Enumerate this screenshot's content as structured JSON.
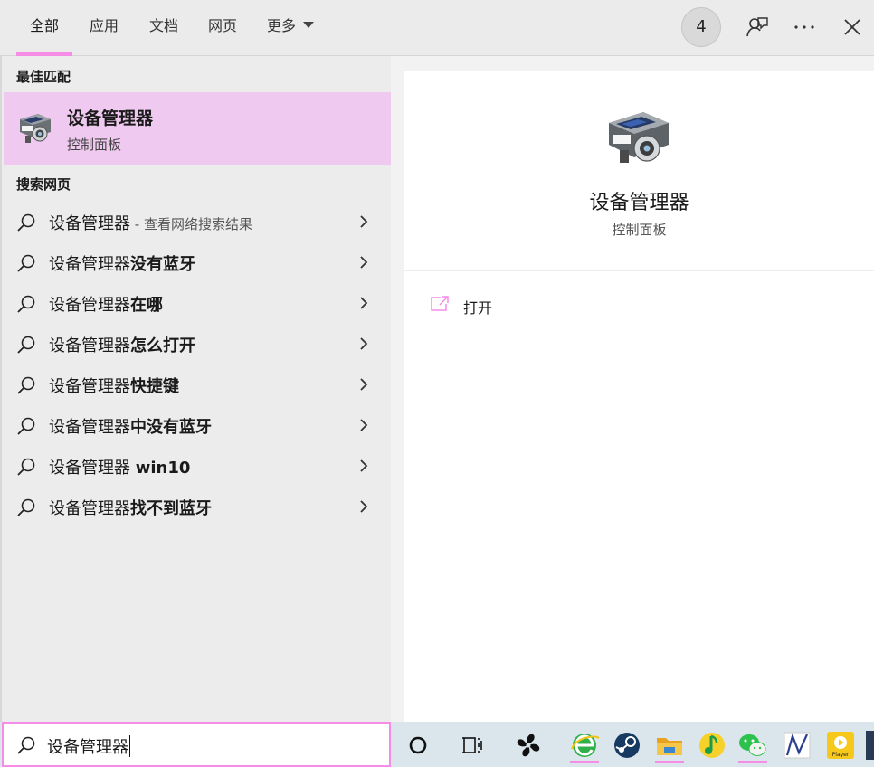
{
  "tabs": [
    {
      "label": "全部",
      "active": true
    },
    {
      "label": "应用",
      "active": false
    },
    {
      "label": "文档",
      "active": false
    },
    {
      "label": "网页",
      "active": false
    },
    {
      "label": "更多",
      "active": false
    }
  ],
  "top_actions": {
    "reward_count": "4",
    "icons": [
      "feedback-icon",
      "more-icon",
      "close-icon"
    ]
  },
  "best_match": {
    "section_title": "最佳匹配",
    "title": "设备管理器",
    "subtitle": "控制面板",
    "icon": "device-manager-icon"
  },
  "web_search": {
    "section_title": "搜索网页",
    "items": [
      {
        "base": "设备管理器",
        "bold": "",
        "hint": " - 查看网络搜索结果"
      },
      {
        "base": "设备管理器",
        "bold": "没有蓝牙",
        "hint": ""
      },
      {
        "base": "设备管理器",
        "bold": "在哪",
        "hint": ""
      },
      {
        "base": "设备管理器",
        "bold": "怎么打开",
        "hint": ""
      },
      {
        "base": "设备管理器",
        "bold": "快捷键",
        "hint": ""
      },
      {
        "base": "设备管理器",
        "bold": "中没有蓝牙",
        "hint": ""
      },
      {
        "base": "设备管理器 ",
        "bold": "win10",
        "hint": ""
      },
      {
        "base": "设备管理器",
        "bold": "找不到蓝牙",
        "hint": ""
      }
    ]
  },
  "detail": {
    "title": "设备管理器",
    "subtitle": "控制面板",
    "actions": [
      {
        "label": "打开",
        "icon": "open-icon"
      }
    ]
  },
  "search": {
    "value": "设备管理器",
    "icon": "search-icon"
  },
  "taskbar": {
    "apps": [
      {
        "name": "cortana-icon",
        "active": false
      },
      {
        "name": "task-view-icon",
        "active": false
      },
      {
        "name": "fan-app-icon",
        "active": false
      },
      {
        "name": "browser-icon",
        "active": true
      },
      {
        "name": "steam-icon",
        "active": false
      },
      {
        "name": "file-explorer-icon",
        "active": true
      },
      {
        "name": "music-app-icon",
        "active": false
      },
      {
        "name": "wechat-icon",
        "active": true
      },
      {
        "name": "graph-app-icon",
        "active": false
      },
      {
        "name": "video-player-icon",
        "active": false
      }
    ],
    "player_text": "Player"
  },
  "colors": {
    "accent": "#f58ce6",
    "best_match_bg": "#efc9ef",
    "pane_bg": "#ececec",
    "taskbar_bg": "#dbe6ec"
  }
}
